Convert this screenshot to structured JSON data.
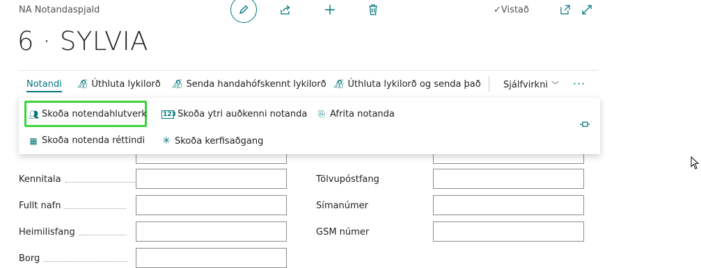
{
  "header": {
    "caption": "NA Notandaspjald",
    "saved_label": "Vistað"
  },
  "record": {
    "title": "6 · SYLVIA"
  },
  "actions": {
    "notandi": "Notandi",
    "assign_password": "Úthluta lykilorð",
    "send_random_password": "Senda handahófskennt lykilorð",
    "assign_and_send_password": "Úthluta lykilorð og senda það",
    "automation": "Sjálfvirkni",
    "more": "···"
  },
  "dropdown": {
    "items": [
      "Skoða notendahlutverk",
      "Skoða ytri auðkenni notanda",
      "Afrita notanda",
      "Skoða notenda réttindi",
      "Skoða kerfisaðgang"
    ]
  },
  "form": {
    "left_labels": [
      "Kennitala",
      "Fullt nafn",
      "Heimilisfang",
      "Borg"
    ],
    "right_labels": [
      "Tölvupóstfang",
      "Símanúmer",
      "GSM númer"
    ]
  },
  "colors": {
    "accent": "#00757a",
    "highlight": "#3bd33b"
  }
}
